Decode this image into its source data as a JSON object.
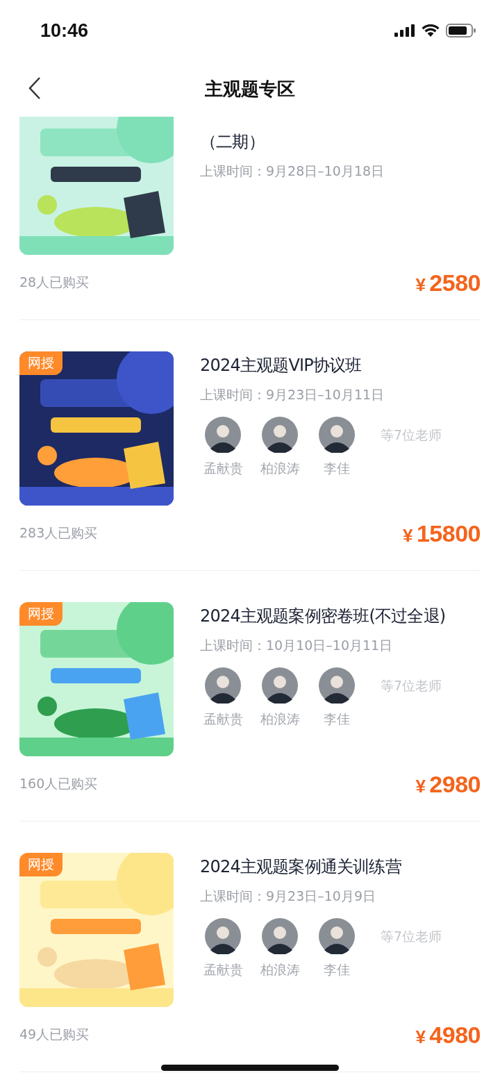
{
  "status_bar": {
    "time": "10:46"
  },
  "header": {
    "title": "主观题专区"
  },
  "courses": [
    {
      "title": "（二期）",
      "schedule": "上课时间：9月28日–10月18日",
      "buyers": "28人已购买",
      "currency": "¥",
      "price": "2580",
      "cropped": true
    },
    {
      "badge": "网授",
      "title": "2024主观题VIP协议班",
      "schedule": "上课时间：9月23日–10月11日",
      "teachers": [
        "孟献贵",
        "柏浪涛",
        "李佳"
      ],
      "more_teachers": "等7位老师",
      "buyers": "283人已购买",
      "currency": "¥",
      "price": "15800",
      "cropped": false
    },
    {
      "badge": "网授",
      "title": "2024主观题案例密卷班(不过全退)",
      "schedule": "上课时间：10月10日–10月11日",
      "teachers": [
        "孟献贵",
        "柏浪涛",
        "李佳"
      ],
      "more_teachers": "等7位老师",
      "buyers": "160人已购买",
      "currency": "¥",
      "price": "2980",
      "cropped": false
    },
    {
      "badge": "网授",
      "title": "2024主观题案例通关训练营",
      "schedule": "上课时间：9月23日–10月9日",
      "teachers": [
        "孟献贵",
        "柏浪涛",
        "李佳"
      ],
      "more_teachers": "等7位老师",
      "buyers": "49人已购买",
      "currency": "¥",
      "price": "4980",
      "cropped": false
    }
  ]
}
